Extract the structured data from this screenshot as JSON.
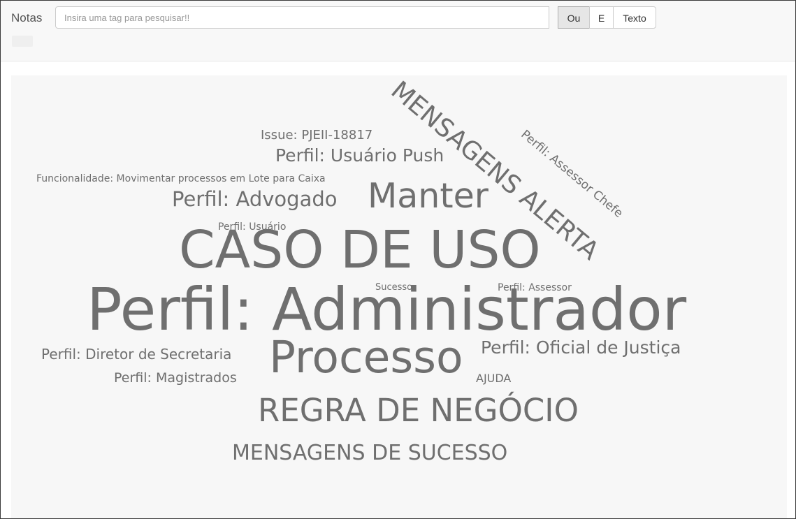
{
  "navbar": {
    "brand": "Notas",
    "search_placeholder": "Insira uma tag para pesquisar!!",
    "search_value": "",
    "buttons": {
      "or_label": "Ou",
      "and_label": "E",
      "text_label": "Texto"
    }
  },
  "cloud": {
    "words": [
      {
        "text": "MENSAGENS ALERTA",
        "size": 6
      },
      {
        "text": "Perfil: Assessor Chefe",
        "size": 2
      },
      {
        "text": "Issue: PJEII-18817",
        "size": 2
      },
      {
        "text": "Perfil: Usuário Push",
        "size": 3
      },
      {
        "text": "Funcionalidade: Movimentar processos em Lote para Caixa",
        "size": 1
      },
      {
        "text": "Perfil: Advogado",
        "size": 3
      },
      {
        "text": "Manter",
        "size": 6
      },
      {
        "text": "Perfil: Usuário",
        "size": 1
      },
      {
        "text": "CASO DE USO",
        "size": 8
      },
      {
        "text": "Sucesso",
        "size": 1
      },
      {
        "text": "Perfil: Assessor",
        "size": 1
      },
      {
        "text": "Perfil: Administrador",
        "size": 10
      },
      {
        "text": "Perfil: Diretor de Secretaria",
        "size": 2
      },
      {
        "text": "Processo",
        "size": 7
      },
      {
        "text": "Perfil: Oficial de Justiça",
        "size": 3
      },
      {
        "text": "Perfil: Magistrados",
        "size": 2
      },
      {
        "text": "AJUDA",
        "size": 1
      },
      {
        "text": "REGRA DE NEGÓCIO",
        "size": 6
      },
      {
        "text": "MENSAGENS DE SUCESSO",
        "size": 4
      }
    ]
  }
}
